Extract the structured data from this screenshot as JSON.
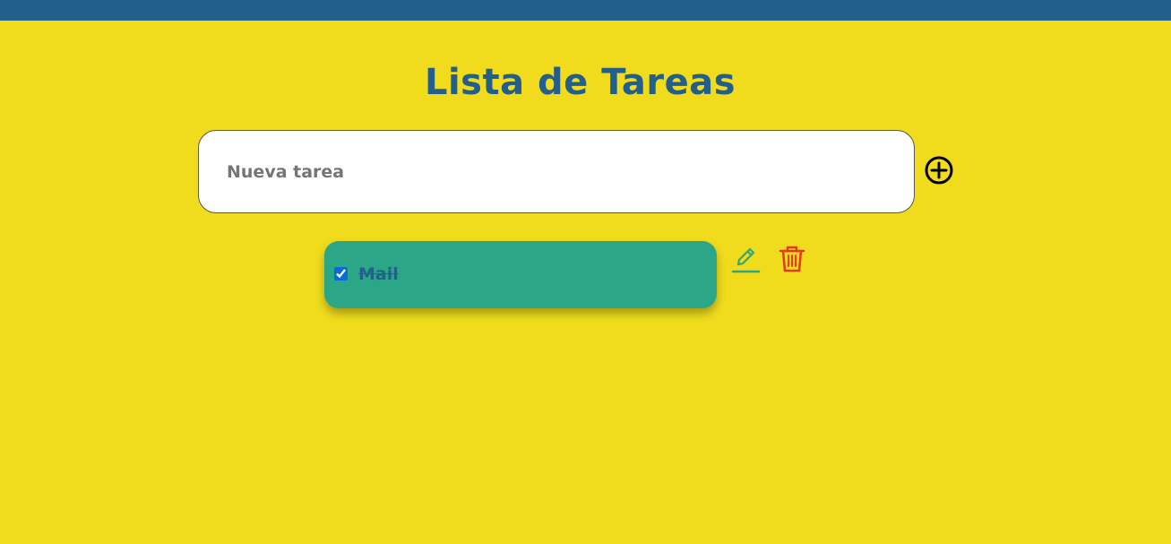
{
  "header": {
    "bar_color": "#22608b"
  },
  "page": {
    "title": "Lista de Tareas",
    "background": "#f0dc1d"
  },
  "new_task": {
    "placeholder": "Nueva tarea",
    "value": "",
    "add_icon": "plus-circle-icon"
  },
  "tasks": [
    {
      "text": "Mail",
      "completed": true,
      "card_color": "#2ba787",
      "edit_icon": "pencil-icon",
      "edit_color": "#2ba787",
      "delete_icon": "trash-icon",
      "delete_color": "#e8361f"
    }
  ]
}
